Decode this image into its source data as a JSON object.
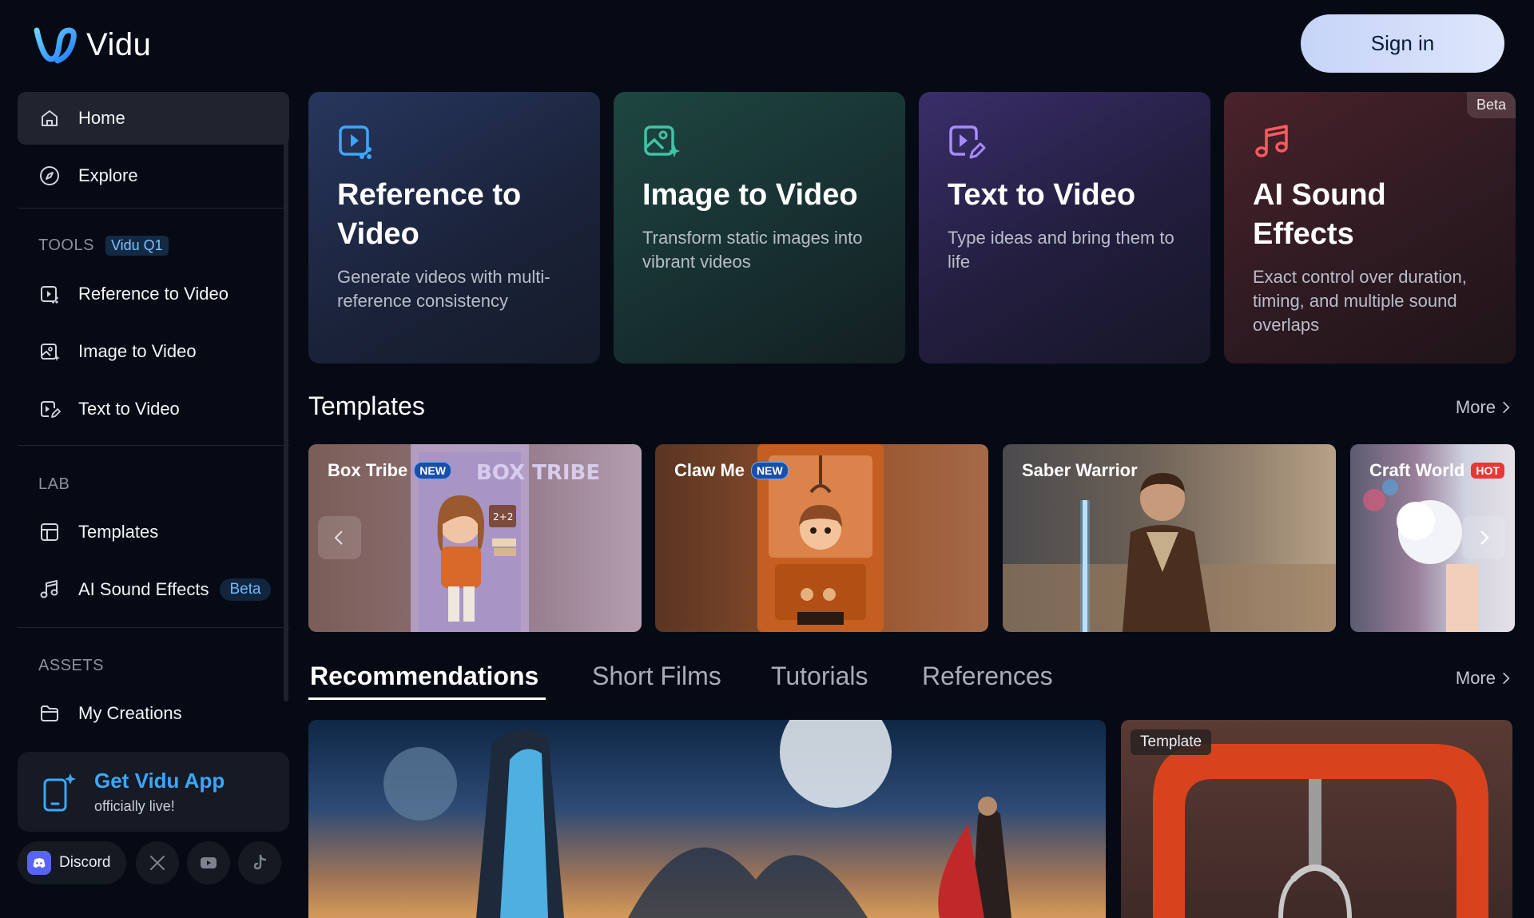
{
  "brand": {
    "name": "Vidu",
    "accent": "#3aa7ff"
  },
  "header": {
    "signin_label": "Sign in"
  },
  "sidebar": {
    "home": "Home",
    "explore": "Explore",
    "tools_label": "TOOLS",
    "tools_pill": "Vidu Q1",
    "tools": [
      "Reference to Video",
      "Image to Video",
      "Text to Video"
    ],
    "lab_label": "LAB",
    "lab": {
      "templates": "Templates",
      "sound": "AI Sound Effects",
      "sound_badge": "Beta"
    },
    "assets_label": "ASSETS",
    "my_creations": "My Creations",
    "app": {
      "title": "Get Vidu App",
      "subtitle": "officially live!"
    },
    "discord": "Discord"
  },
  "tools": [
    {
      "title": "Reference to Video",
      "desc": "Generate videos with multi-reference consistency"
    },
    {
      "title": "Image to Video",
      "desc": "Transform static images into vibrant videos"
    },
    {
      "title": "Text to Video",
      "desc": "Type ideas and bring them to life"
    },
    {
      "title": "AI Sound Effects",
      "desc": "Exact control over duration, timing, and multiple sound overlaps",
      "tag": "Beta"
    }
  ],
  "templates": {
    "title": "Templates",
    "more": "More",
    "items": [
      {
        "name": "Box Tribe",
        "badge": "NEW"
      },
      {
        "name": "Claw Me",
        "badge": "NEW"
      },
      {
        "name": "Saber Warrior",
        "badge": ""
      },
      {
        "name": "Craft World",
        "badge": "HOT"
      }
    ],
    "box_text": "BOX TRIBE",
    "box_sticker": "2+2"
  },
  "tabs": {
    "items": [
      "Recommendations",
      "Short Films",
      "Tutorials",
      "References"
    ],
    "more": "More"
  },
  "recommendations": {
    "tag": "Template"
  }
}
